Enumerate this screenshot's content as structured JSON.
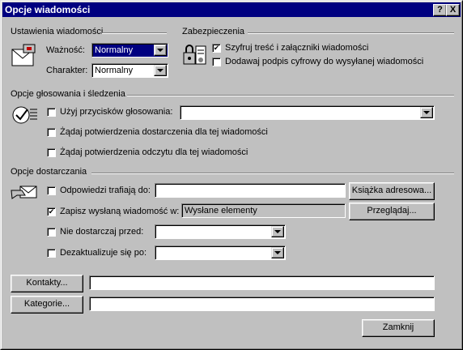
{
  "window": {
    "title": "Opcje wiadomości",
    "help_btn": "?",
    "close_btn": "X"
  },
  "settings": {
    "group_label": "Ustawienia wiadomości",
    "importance_label": "Ważność:",
    "importance_value": "Normalny",
    "sensitivity_label": "Charakter:",
    "sensitivity_value": "Normalny"
  },
  "security": {
    "group_label": "Zabezpieczenia",
    "encrypt_label": "Szyfruj treść i załączniki wiadomości",
    "encrypt_checked": true,
    "sign_label": "Dodawaj podpis cyfrowy do wysyłanej wiadomości",
    "sign_checked": false
  },
  "voting": {
    "group_label": "Opcje głosowania i śledzenia",
    "voting_buttons_label": "Użyj przycisków głosowania:",
    "voting_buttons_value": "",
    "delivery_receipt_label": "Żądaj potwierdzenia dostarczenia dla tej wiadomości",
    "read_receipt_label": "Żądaj potwierdzenia odczytu dla tej wiadomości"
  },
  "delivery": {
    "group_label": "Opcje dostarczania",
    "replies_to_label": "Odpowiedzi trafiają do:",
    "replies_to_value": "",
    "address_book_button": "Książka adresowa...",
    "save_sent_label": "Zapisz wysłaną wiadomość w:",
    "save_sent_value": "Wysłane elementy",
    "save_sent_checked": true,
    "browse_button": "Przeglądaj...",
    "do_not_deliver_label": "Nie dostarczaj przed:",
    "do_not_deliver_value": "",
    "expires_label": "Dezaktualizuje się po:",
    "expires_value": ""
  },
  "contacts": {
    "button": "Kontakty...",
    "value": ""
  },
  "categories": {
    "button": "Kategorie...",
    "value": ""
  },
  "footer": {
    "close_button": "Zamknij"
  }
}
